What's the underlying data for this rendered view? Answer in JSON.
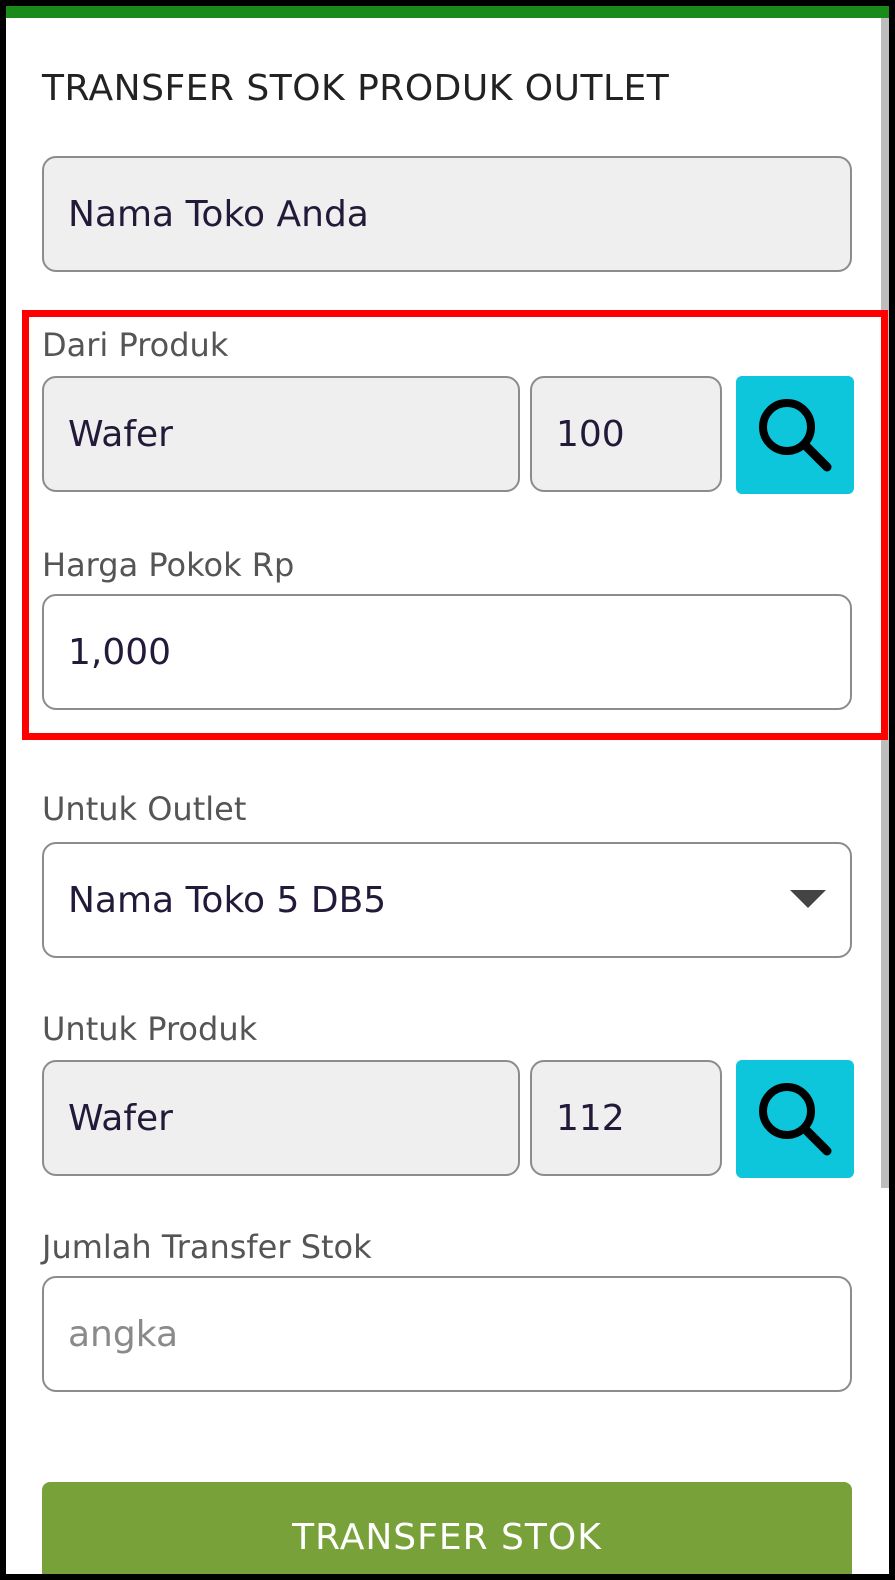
{
  "page": {
    "title": "TRANSFER STOK PRODUK OUTLET"
  },
  "store": {
    "name": "Nama Toko Anda"
  },
  "from_product": {
    "label": "Dari Produk",
    "name": "Wafer",
    "qty": "100"
  },
  "cost_price": {
    "label": "Harga Pokok Rp",
    "value": "1,000"
  },
  "to_outlet": {
    "label": "Untuk Outlet",
    "selected": "Nama Toko 5 DB5"
  },
  "to_product": {
    "label": "Untuk Produk",
    "name": "Wafer",
    "qty": "112"
  },
  "transfer_qty": {
    "label": "Jumlah Transfer Stok",
    "placeholder": "angka"
  },
  "submit": {
    "label": "TRANSFER STOK"
  },
  "colors": {
    "topbar": "#1a8a1a",
    "search_button": "#0dc6db",
    "submit_button": "#78a13a",
    "highlight": "#ff0000"
  }
}
